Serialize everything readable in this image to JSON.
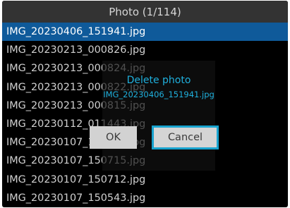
{
  "header": {
    "title": "Photo (1/114)"
  },
  "files": [
    "IMG_20230406_151941.jpg",
    "IMG_20230213_000826.jpg",
    "IMG_20230213_000824.jpg",
    "IMG_20230213_000822.jpg",
    "IMG_20230213_000815.jpg",
    "IMG_20230112_011443.jpg",
    "IMG_20230107_150721.jpg",
    "IMG_20230107_150715.jpg",
    "IMG_20230107_150712.jpg",
    "IMG_20230107_150543.jpg"
  ],
  "selected_index": 0,
  "dialog": {
    "title": "Delete photo",
    "filename": "IMG_20230406_151941.jpg",
    "ok_label": "OK",
    "cancel_label": "Cancel"
  },
  "colors": {
    "selection": "#0f5a9a",
    "dialog_text": "#1fb0dd",
    "focus_border": "#18a3cf"
  }
}
